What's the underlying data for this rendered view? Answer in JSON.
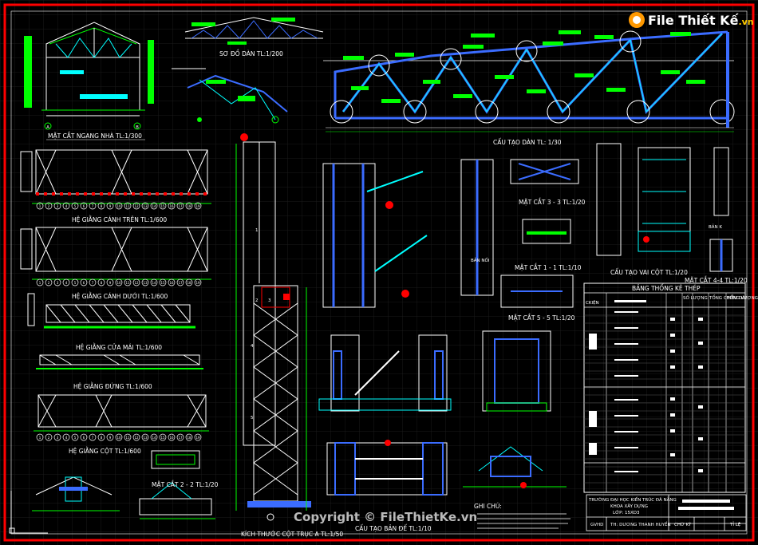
{
  "logo": {
    "text": "File Thiết Kế",
    "suffix": ".vn"
  },
  "labels": {
    "mat_cat_ngang": "MẶT CẮT NGANG NHÀ TL:1/300",
    "so_do_dan": "SƠ ĐỒ DÀN TL:1/200",
    "cau_tao_dan": "CẤU TẠO DÀN TL: 1/30",
    "he_giang_canh_tren": "HỆ GIẰNG CÁNH TRÊN TL:1/600",
    "he_giang_canh_duoi": "HỆ GIẰNG CÁNH DƯỚI TL:1/600",
    "he_giang_cua_mai": "HỆ GIẰNG CỬA MÁI TL:1/600",
    "he_giang_dung": "HỆ GIẰNG ĐỨNG TL:1/600",
    "he_giang_cot": "HỆ GIẰNG CỘT TL:1/600",
    "mat_cat_33": "MẶT CẮT 3 - 3 TL:1/20",
    "mat_cat_11": "MẶT CẮT 1 - 1 TL:1/10",
    "cau_tao_vai_cot": "CẤU TẠO VAI CỘT TL:1/20",
    "mat_cat_44": "MẶT CẮT 4-4 TL:1/20",
    "mat_cat_55": "MẶT CẮT 5 - 5 TL:1/20",
    "mat_cat_22": "MẶT CẮT 2 - 2 TL:1/20",
    "kich_thuoc_cot": "KÍCH THƯỚC CỘT TRỤC A TL:1/50",
    "cau_tao_ban_de": "CẤU TẠO BẢN ĐẾ TL:1/10",
    "ghi_chu": "GHI CHÚ:",
    "bang_thong_ke": "BẢNG THỐNG KÊ THÉP",
    "ban_noi": "BẢN NỐI",
    "ban_k": "BẢN K"
  },
  "title_block": {
    "school": "TRƯỜNG ĐẠI HỌC KIẾN TRÚC ĐÀ NẴNG",
    "faculty": "KHOA XÂY DỰNG",
    "class": "LỚP: 15XD3",
    "gvhd": "GVHD",
    "student": "TH: DƯƠNG THANH HUYỀN",
    "chu_ky": "CHỮ KÝ",
    "ti_le": "TỈ LỆ"
  },
  "table": {
    "headers": [
      "CKIỆN",
      "SỐ LƯỢNG",
      "TỔNG CHIỀU DÀI",
      "TỔNG LƯỢNG"
    ]
  },
  "axis_letters": [
    "A",
    "B"
  ],
  "grid_numbers": [
    "1",
    "2",
    "3",
    "4",
    "5",
    "6",
    "7",
    "8",
    "9",
    "10",
    "11",
    "12",
    "13",
    "14",
    "15",
    "16",
    "17",
    "18",
    "19"
  ],
  "column_marks": [
    "1",
    "2",
    "3",
    "4",
    "5"
  ],
  "watermark": "Copyright © FileThietKe.vn",
  "colors": {
    "frame": "#ff0000",
    "green": "#00ff00",
    "cyan": "#00ffff",
    "blue": "#3b6cff",
    "white": "#ffffff"
  }
}
